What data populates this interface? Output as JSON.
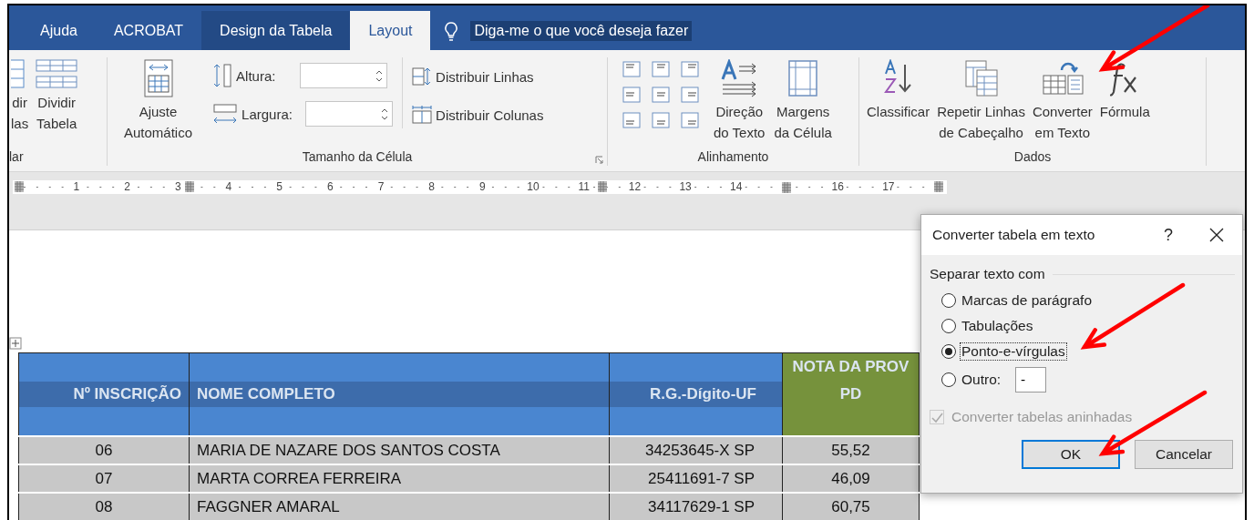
{
  "tabs": [
    {
      "label": "Ajuda",
      "selected": false,
      "kind": "plain"
    },
    {
      "label": "ACROBAT",
      "selected": false,
      "kind": "plain"
    },
    {
      "label": "Design da Tabela",
      "selected": false,
      "kind": "context"
    },
    {
      "label": "Layout",
      "selected": true,
      "kind": "context"
    }
  ],
  "tell_me": "Diga-me o que você deseja fazer",
  "ribbon": {
    "groups": [
      {
        "kind": "merge",
        "label": "lar",
        "buttons": [
          {
            "lines": [
              "dir",
              "las"
            ]
          },
          {
            "lines": [
              "Dividir",
              "Tabela"
            ]
          }
        ]
      },
      {
        "kind": "cell_size",
        "label": "Tamanho da Célula",
        "autofit": {
          "lines": [
            "Ajuste",
            "Automático"
          ]
        },
        "fields": [
          {
            "label": "Altura:"
          },
          {
            "label": "Largura:"
          }
        ],
        "distribute": [
          {
            "label": "Distribuir Linhas"
          },
          {
            "label": "Distribuir Colunas"
          }
        ]
      },
      {
        "kind": "alignment",
        "label": "Alinhamento",
        "buttons": [
          {
            "lines": [
              "Direção",
              "do Texto"
            ]
          },
          {
            "lines": [
              "Margens",
              "da Célula"
            ]
          }
        ]
      },
      {
        "kind": "data",
        "label": "Dados",
        "buttons": [
          {
            "lines": [
              "Classificar"
            ]
          },
          {
            "lines": [
              "Repetir Linhas",
              "de Cabeçalho"
            ]
          },
          {
            "lines": [
              "Converter",
              "em Texto"
            ]
          },
          {
            "lines": [
              "Fórmula"
            ]
          }
        ]
      }
    ]
  },
  "ruler": {
    "items": [
      {
        "kind": "number",
        "label": "1"
      },
      {
        "kind": "number",
        "label": "2"
      },
      {
        "kind": "number",
        "label": "3"
      },
      {
        "kind": "number",
        "label": "4"
      },
      {
        "kind": "number",
        "label": "5"
      },
      {
        "kind": "number",
        "label": "6"
      },
      {
        "kind": "number",
        "label": "7"
      },
      {
        "kind": "number",
        "label": "8"
      },
      {
        "kind": "number",
        "label": "9"
      },
      {
        "kind": "number",
        "label": "10"
      },
      {
        "kind": "number",
        "label": "11"
      },
      {
        "kind": "number",
        "label": "12"
      },
      {
        "kind": "number",
        "label": "13"
      },
      {
        "kind": "number",
        "label": "14"
      },
      {
        "kind": "marker"
      },
      {
        "kind": "number",
        "label": "16"
      },
      {
        "kind": "number",
        "label": "17"
      }
    ]
  },
  "table": {
    "columns": [
      {
        "lines": [
          "Nº INSCRIÇÃO"
        ],
        "color": "#4a86d0"
      },
      {
        "lines": [
          "NOME COMPLETO"
        ],
        "color": "#4a86d0"
      },
      {
        "lines": [
          "R.G.-Dígito-UF"
        ],
        "color": "#4a86d0"
      },
      {
        "lines": [
          "NOTA DA PROV",
          "PD"
        ],
        "color": "#76923c"
      }
    ],
    "rows": [
      [
        "06",
        "MARIA DE NAZARE DOS SANTOS COSTA",
        "34253645-X SP",
        "55,52"
      ],
      [
        "07",
        "MARTA CORREA FERREIRA",
        "25411691-7 SP",
        "46,09"
      ],
      [
        "08",
        "FAGGNER AMARAL",
        "34117629-1 SP",
        "60,75"
      ]
    ]
  },
  "dialog": {
    "title": "Converter tabela em texto",
    "help": "?",
    "section": "Separar texto com",
    "options": [
      {
        "label": "Marcas de parágrafo",
        "selected": false,
        "focused": false
      },
      {
        "label": "Tabulações",
        "selected": false,
        "focused": false
      },
      {
        "label": "Ponto-e-vírgulas",
        "selected": true,
        "focused": true
      },
      {
        "label": "Outro:",
        "selected": false,
        "focused": false
      }
    ],
    "other_value": "-",
    "nested": {
      "label": "Converter tabelas aninhadas",
      "checked": true,
      "disabled": true
    },
    "buttons": [
      {
        "label": "OK",
        "default": true
      },
      {
        "label": "Cancelar",
        "default": false
      }
    ]
  }
}
